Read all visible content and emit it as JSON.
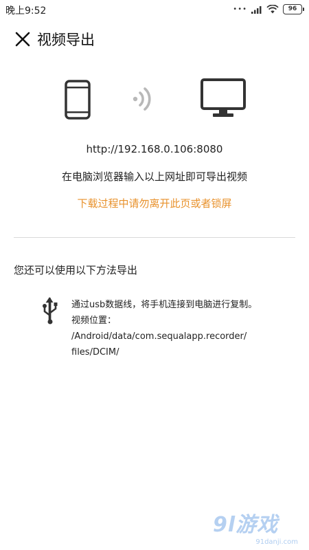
{
  "status_bar": {
    "time": "晚上9:52",
    "battery": "96"
  },
  "header": {
    "title": "视频导出"
  },
  "transfer": {
    "url": "http://192.168.0.106:8080",
    "instruction": "在电脑浏览器输入以上网址即可导出视频",
    "warning": "下载过程中请勿离开此页或者锁屏"
  },
  "alternative": {
    "title": "您还可以使用以下方法导出",
    "usb_line": "通过usb数据线，将手机连接到电脑进行复制。",
    "location_label": "视频位置：",
    "path_line1": "/Android/data/com.sequalapp.recorder/",
    "path_line2": "files/DCIM/"
  },
  "watermark": {
    "main": "9l游戏",
    "sub": "91danji.com"
  },
  "colors": {
    "warning": "#e8912b",
    "icon": "#333333",
    "signal": "#b8b8b8"
  },
  "icons": {
    "close": "close-icon",
    "phone": "phone-icon",
    "signal": "wifi-signal-icon",
    "monitor": "monitor-icon",
    "usb": "usb-icon"
  }
}
